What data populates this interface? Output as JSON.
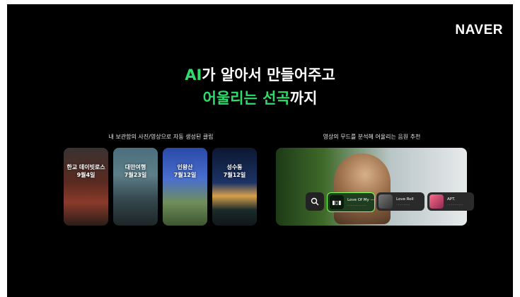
{
  "brand": {
    "logo": "NAVER"
  },
  "headline": {
    "line1_accent": "AI",
    "line1_rest": "가 알아서 만들어주고",
    "line2_accent": "어울리는 선곡",
    "line2_rest": "까지"
  },
  "left_panel": {
    "caption": "내 보관함의 사진/영상으로 자동 생성된 클립",
    "cards": [
      {
        "title": "한교 데이빗로스",
        "date": "9월4일"
      },
      {
        "title": "대만여행",
        "date": "7월23일"
      },
      {
        "title": "인왕산",
        "date": "7월12일"
      },
      {
        "title": "성수동",
        "date": "7월12일"
      }
    ]
  },
  "right_panel": {
    "caption": "영상의 무드를 분석해 어울리는 음원 추천",
    "songs": [
      {
        "title": "Love Of My —",
        "artist": "………………"
      },
      {
        "title": "Love Roll",
        "artist": "…… ……"
      },
      {
        "title": "APT.",
        "artist": "……………"
      }
    ]
  },
  "colors": {
    "accent": "#2fdc6b",
    "selected_outline": "#7dff55",
    "background": "#000000"
  }
}
